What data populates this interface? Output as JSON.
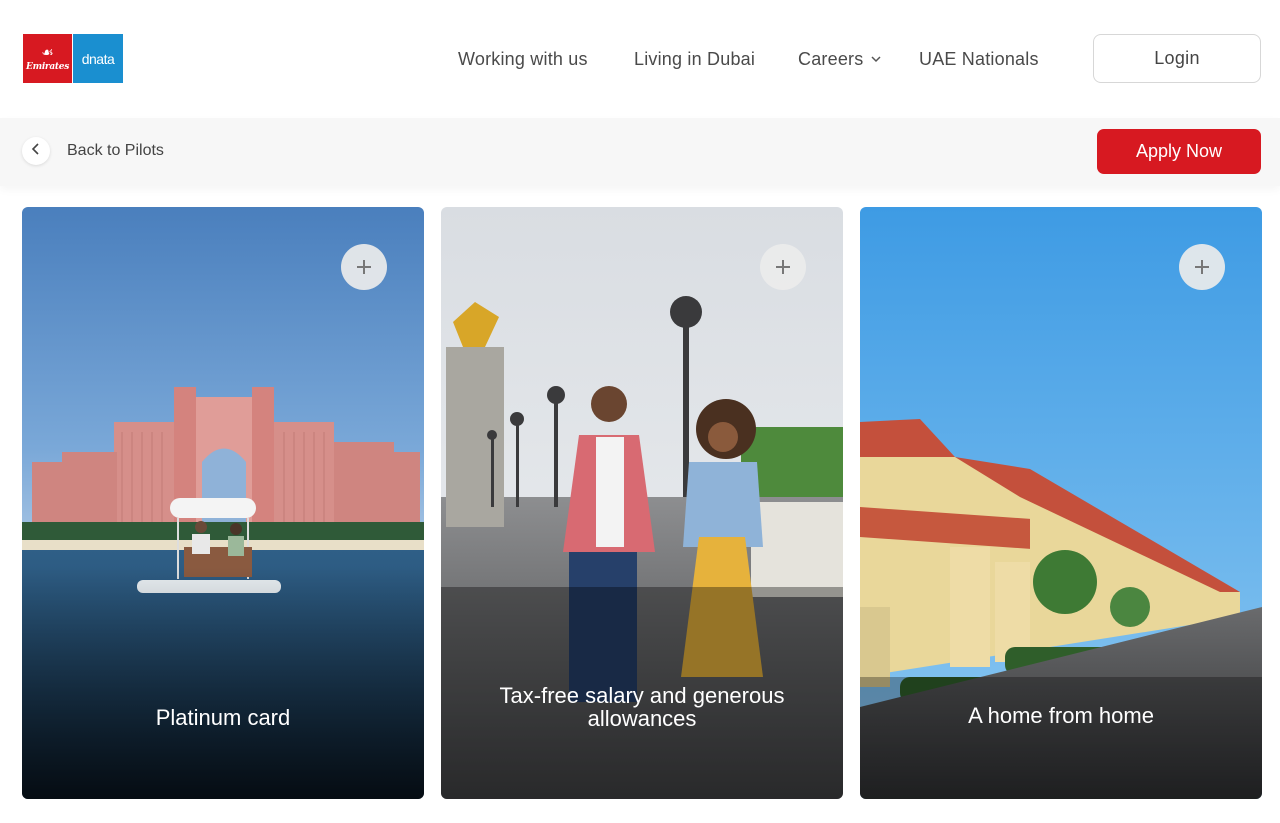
{
  "header": {
    "logo": {
      "emirates_text": "Emirates",
      "dnata_text": "dnata"
    },
    "nav": [
      {
        "label": "Working with us"
      },
      {
        "label": "Living in Dubai"
      },
      {
        "label": "Careers",
        "has_dropdown": true
      },
      {
        "label": "UAE Nationals"
      }
    ],
    "login_label": "Login"
  },
  "subbar": {
    "back_label": "Back to Pilots",
    "apply_label": "Apply Now"
  },
  "cards": [
    {
      "caption": "Platinum card",
      "icon": "plus-icon"
    },
    {
      "caption": "Tax-free salary and generous allowances",
      "icon": "plus-icon"
    },
    {
      "caption": "A home from home",
      "icon": "plus-icon"
    }
  ],
  "colors": {
    "brand_red": "#d71921",
    "dnata_blue": "#1a8fd0"
  }
}
